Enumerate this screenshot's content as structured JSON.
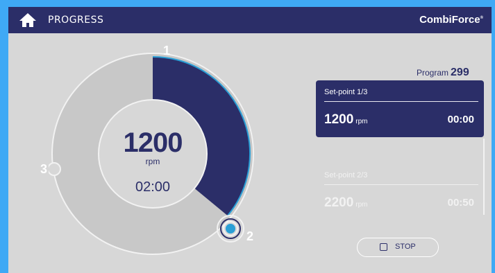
{
  "header": {
    "title": "PROGRESS",
    "brand": "CombiForce",
    "brand_mark": "®",
    "home_icon": "home-icon"
  },
  "gauge": {
    "current_rpm": "1200",
    "unit": "rpm",
    "time": "02:00",
    "marker_1": "1",
    "marker_2": "2",
    "marker_3": "3",
    "progress_fraction": 0.36
  },
  "program": {
    "label": "Program",
    "number": "299"
  },
  "setpoints": [
    {
      "label": "Set-point 1/3",
      "rpm": "1200",
      "unit": "rpm",
      "time": "00:00",
      "active": true
    },
    {
      "label": "Set-point 2/3",
      "rpm": "2200",
      "unit": "rpm",
      "time": "00:50",
      "active": false
    }
  ],
  "controls": {
    "stop_label": "STOP",
    "stop_icon": "stop-square-icon"
  },
  "colors": {
    "navy": "#2b2e68",
    "accent": "#2a9fd6",
    "background": "#d7d7d7",
    "frame": "#3fa9f5"
  }
}
